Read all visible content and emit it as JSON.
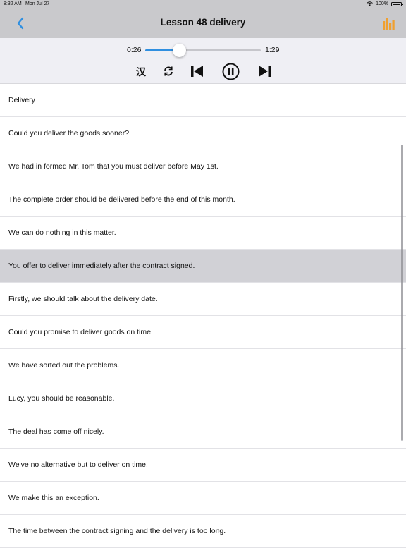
{
  "status_bar": {
    "time": "8:32 AM",
    "date": "Mon Jul 27",
    "battery": "100%",
    "wifi_icon": "wifi-icon",
    "battery_icon": "battery-icon"
  },
  "nav": {
    "title": "Lesson 48 delivery",
    "back_icon": "chevron-left-icon",
    "chart_icon": "bar-chart-icon",
    "accent_color": "#f0a030",
    "back_color": "#2f8fe0"
  },
  "player": {
    "elapsed": "0:26",
    "total": "1:29",
    "progress": 0.29,
    "chinese_toggle": "汉",
    "progress_color": "#2f8fe0",
    "icons": [
      "repeat-icon",
      "skip-back-icon",
      "pause-icon",
      "skip-forward-icon"
    ]
  },
  "sentences": {
    "selected_index": 5,
    "items": [
      "Delivery",
      "Could you deliver the goods sooner?",
      "We had in formed Mr. Tom that you must deliver before May 1st.",
      "The complete order should be delivered before the end of this month.",
      "We can do nothing in this matter.",
      "You offer to deliver immediately after the contract signed.",
      "Firstly, we should talk about the delivery date.",
      "Could you promise to deliver goods on time.",
      "We have sorted out the problems.",
      "Lucy, you should be reasonable.",
      "The deal has come off nicely.",
      "We've no alternative but to deliver on time.",
      "We make this an exception.",
      "The time between the contract signing and the delivery is too long."
    ]
  }
}
